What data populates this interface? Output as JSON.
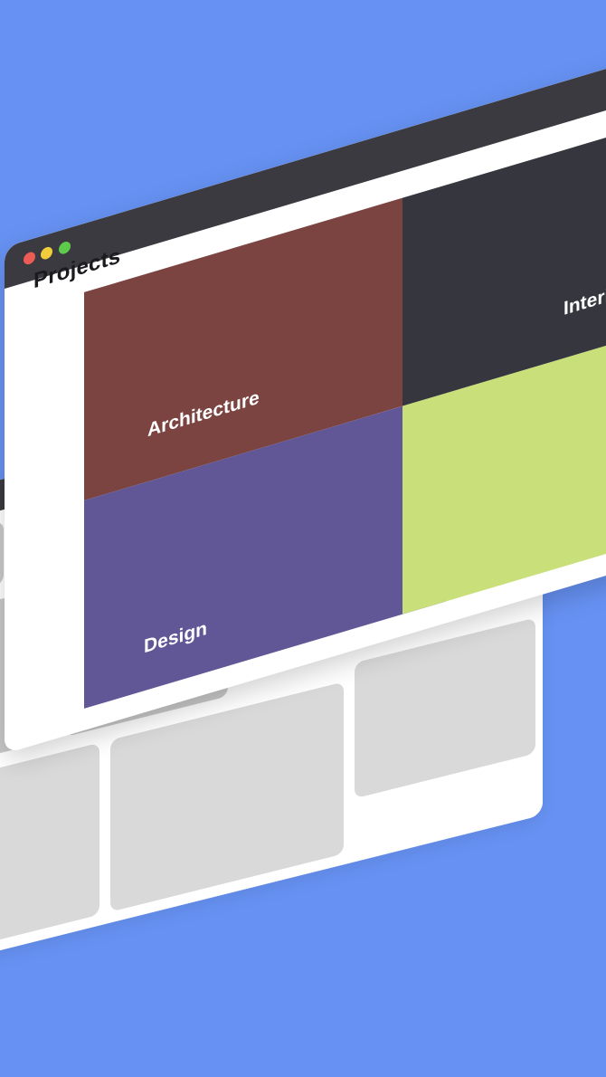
{
  "background_color": "#6792f3",
  "front_window": {
    "title": "Projects",
    "traffic_lights": [
      "close-dot",
      "minimize-dot",
      "zoom-dot"
    ],
    "tiles": [
      {
        "label": "Architecture",
        "color": "#7b4440"
      },
      {
        "label": "Interi",
        "color": "#36363e"
      },
      {
        "label": "Design",
        "color": "#625796"
      },
      {
        "label": "",
        "color": "#c8df7a"
      }
    ]
  },
  "back_window": {
    "titlebar_color": "#3a3a40",
    "tile_color": "#d9d9d9"
  }
}
